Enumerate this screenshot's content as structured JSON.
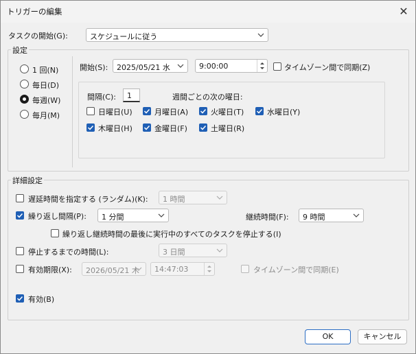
{
  "window": {
    "title": "トリガーの編集",
    "close_icon": "close-icon"
  },
  "begin_task": {
    "label": "タスクの開始(G):",
    "value": "スケジュールに従う"
  },
  "settings": {
    "group_label": "設定",
    "radios": [
      {
        "label": "1 回(N)",
        "checked": false
      },
      {
        "label": "毎日(D)",
        "checked": false
      },
      {
        "label": "毎週(W)",
        "checked": true
      },
      {
        "label": "毎月(M)",
        "checked": false
      }
    ],
    "start_label": "開始(S):",
    "start_date": "2025/05/21 水",
    "start_time": "9:00:00",
    "sync_tz_label": "タイムゾーン間で同期(Z)",
    "recur_label": "間隔(C):",
    "recur_value": "1",
    "weekday_heading": "週間ごとの次の曜日:",
    "days": [
      {
        "label": "日曜日(U)",
        "checked": false
      },
      {
        "label": "月曜日(A)",
        "checked": true
      },
      {
        "label": "火曜日(T)",
        "checked": true
      },
      {
        "label": "水曜日(Y)",
        "checked": true
      },
      {
        "label": "木曜日(H)",
        "checked": true
      },
      {
        "label": "金曜日(F)",
        "checked": true
      },
      {
        "label": "土曜日(R)",
        "checked": true
      }
    ]
  },
  "advanced": {
    "group_label": "詳細設定",
    "delay_label": "遅延時間を指定する (ランダム)(K):",
    "delay_value": "1 時間",
    "repeat_label": "繰り返し間隔(P):",
    "repeat_value": "1 分間",
    "duration_label": "継続時間(F):",
    "duration_value": "9 時間",
    "stop_running_label": "繰り返し継続時間の最後に実行中のすべてのタスクを停止する(I)",
    "stop_after_label": "停止するまでの時間(L):",
    "stop_after_value": "3 日間",
    "expire_label": "有効期限(X):",
    "expire_date": "2026/05/21 木",
    "expire_time": "14:47:03",
    "expire_sync_label": "タイムゾーン間で同期(E)",
    "enabled_label": "有効(B)"
  },
  "buttons": {
    "ok": "OK",
    "cancel": "キャンセル"
  },
  "colors": {
    "accent": "#1f5fb5",
    "background": "#f0f0f0"
  }
}
